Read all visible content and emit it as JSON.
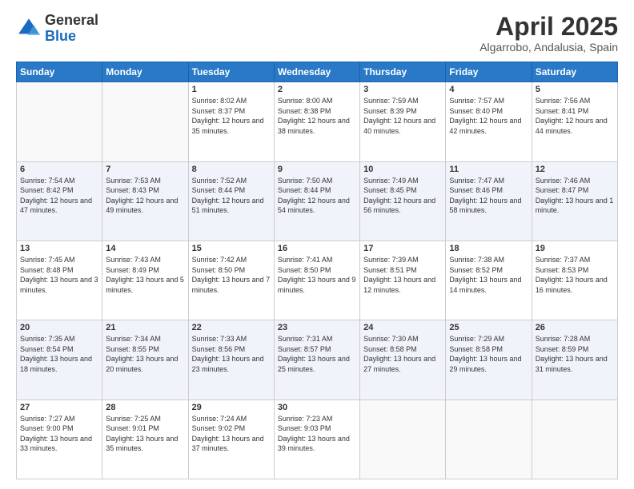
{
  "header": {
    "logo_general": "General",
    "logo_blue": "Blue",
    "title": "April 2025",
    "subtitle": "Algarrobo, Andalusia, Spain"
  },
  "days_of_week": [
    "Sunday",
    "Monday",
    "Tuesday",
    "Wednesday",
    "Thursday",
    "Friday",
    "Saturday"
  ],
  "weeks": [
    [
      {
        "day": "",
        "info": ""
      },
      {
        "day": "",
        "info": ""
      },
      {
        "day": "1",
        "info": "Sunrise: 8:02 AM\nSunset: 8:37 PM\nDaylight: 12 hours and 35 minutes."
      },
      {
        "day": "2",
        "info": "Sunrise: 8:00 AM\nSunset: 8:38 PM\nDaylight: 12 hours and 38 minutes."
      },
      {
        "day": "3",
        "info": "Sunrise: 7:59 AM\nSunset: 8:39 PM\nDaylight: 12 hours and 40 minutes."
      },
      {
        "day": "4",
        "info": "Sunrise: 7:57 AM\nSunset: 8:40 PM\nDaylight: 12 hours and 42 minutes."
      },
      {
        "day": "5",
        "info": "Sunrise: 7:56 AM\nSunset: 8:41 PM\nDaylight: 12 hours and 44 minutes."
      }
    ],
    [
      {
        "day": "6",
        "info": "Sunrise: 7:54 AM\nSunset: 8:42 PM\nDaylight: 12 hours and 47 minutes."
      },
      {
        "day": "7",
        "info": "Sunrise: 7:53 AM\nSunset: 8:43 PM\nDaylight: 12 hours and 49 minutes."
      },
      {
        "day": "8",
        "info": "Sunrise: 7:52 AM\nSunset: 8:44 PM\nDaylight: 12 hours and 51 minutes."
      },
      {
        "day": "9",
        "info": "Sunrise: 7:50 AM\nSunset: 8:44 PM\nDaylight: 12 hours and 54 minutes."
      },
      {
        "day": "10",
        "info": "Sunrise: 7:49 AM\nSunset: 8:45 PM\nDaylight: 12 hours and 56 minutes."
      },
      {
        "day": "11",
        "info": "Sunrise: 7:47 AM\nSunset: 8:46 PM\nDaylight: 12 hours and 58 minutes."
      },
      {
        "day": "12",
        "info": "Sunrise: 7:46 AM\nSunset: 8:47 PM\nDaylight: 13 hours and 1 minute."
      }
    ],
    [
      {
        "day": "13",
        "info": "Sunrise: 7:45 AM\nSunset: 8:48 PM\nDaylight: 13 hours and 3 minutes."
      },
      {
        "day": "14",
        "info": "Sunrise: 7:43 AM\nSunset: 8:49 PM\nDaylight: 13 hours and 5 minutes."
      },
      {
        "day": "15",
        "info": "Sunrise: 7:42 AM\nSunset: 8:50 PM\nDaylight: 13 hours and 7 minutes."
      },
      {
        "day": "16",
        "info": "Sunrise: 7:41 AM\nSunset: 8:50 PM\nDaylight: 13 hours and 9 minutes."
      },
      {
        "day": "17",
        "info": "Sunrise: 7:39 AM\nSunset: 8:51 PM\nDaylight: 13 hours and 12 minutes."
      },
      {
        "day": "18",
        "info": "Sunrise: 7:38 AM\nSunset: 8:52 PM\nDaylight: 13 hours and 14 minutes."
      },
      {
        "day": "19",
        "info": "Sunrise: 7:37 AM\nSunset: 8:53 PM\nDaylight: 13 hours and 16 minutes."
      }
    ],
    [
      {
        "day": "20",
        "info": "Sunrise: 7:35 AM\nSunset: 8:54 PM\nDaylight: 13 hours and 18 minutes."
      },
      {
        "day": "21",
        "info": "Sunrise: 7:34 AM\nSunset: 8:55 PM\nDaylight: 13 hours and 20 minutes."
      },
      {
        "day": "22",
        "info": "Sunrise: 7:33 AM\nSunset: 8:56 PM\nDaylight: 13 hours and 23 minutes."
      },
      {
        "day": "23",
        "info": "Sunrise: 7:31 AM\nSunset: 8:57 PM\nDaylight: 13 hours and 25 minutes."
      },
      {
        "day": "24",
        "info": "Sunrise: 7:30 AM\nSunset: 8:58 PM\nDaylight: 13 hours and 27 minutes."
      },
      {
        "day": "25",
        "info": "Sunrise: 7:29 AM\nSunset: 8:58 PM\nDaylight: 13 hours and 29 minutes."
      },
      {
        "day": "26",
        "info": "Sunrise: 7:28 AM\nSunset: 8:59 PM\nDaylight: 13 hours and 31 minutes."
      }
    ],
    [
      {
        "day": "27",
        "info": "Sunrise: 7:27 AM\nSunset: 9:00 PM\nDaylight: 13 hours and 33 minutes."
      },
      {
        "day": "28",
        "info": "Sunrise: 7:25 AM\nSunset: 9:01 PM\nDaylight: 13 hours and 35 minutes."
      },
      {
        "day": "29",
        "info": "Sunrise: 7:24 AM\nSunset: 9:02 PM\nDaylight: 13 hours and 37 minutes."
      },
      {
        "day": "30",
        "info": "Sunrise: 7:23 AM\nSunset: 9:03 PM\nDaylight: 13 hours and 39 minutes."
      },
      {
        "day": "",
        "info": ""
      },
      {
        "day": "",
        "info": ""
      },
      {
        "day": "",
        "info": ""
      }
    ]
  ]
}
